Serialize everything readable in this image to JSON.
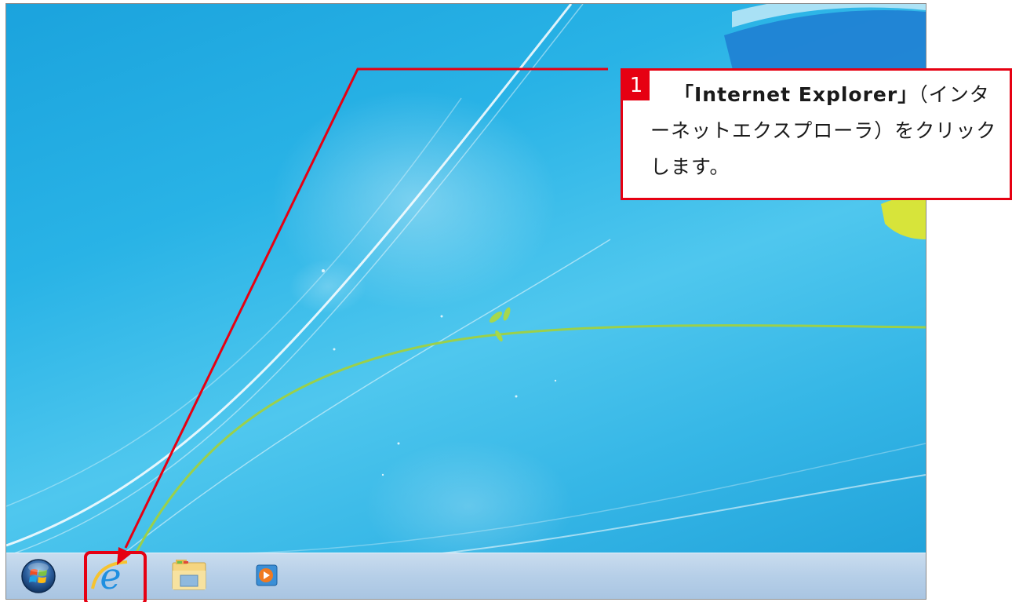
{
  "callout": {
    "step_number": "1",
    "target_label": "「Internet Explorer」",
    "rest_text": "（インターネットエクスプローラ）をクリックします。"
  },
  "taskbar": {
    "items": [
      {
        "icon": "windows-start-orb-icon"
      },
      {
        "icon": "internet-explorer-icon"
      },
      {
        "icon": "windows-explorer-folder-icon"
      },
      {
        "icon": "windows-media-player-icon"
      }
    ]
  },
  "colors": {
    "annotation_red": "#e60012",
    "taskbar": "#b6cfe8",
    "desktop_blue": "#29b3e6"
  }
}
